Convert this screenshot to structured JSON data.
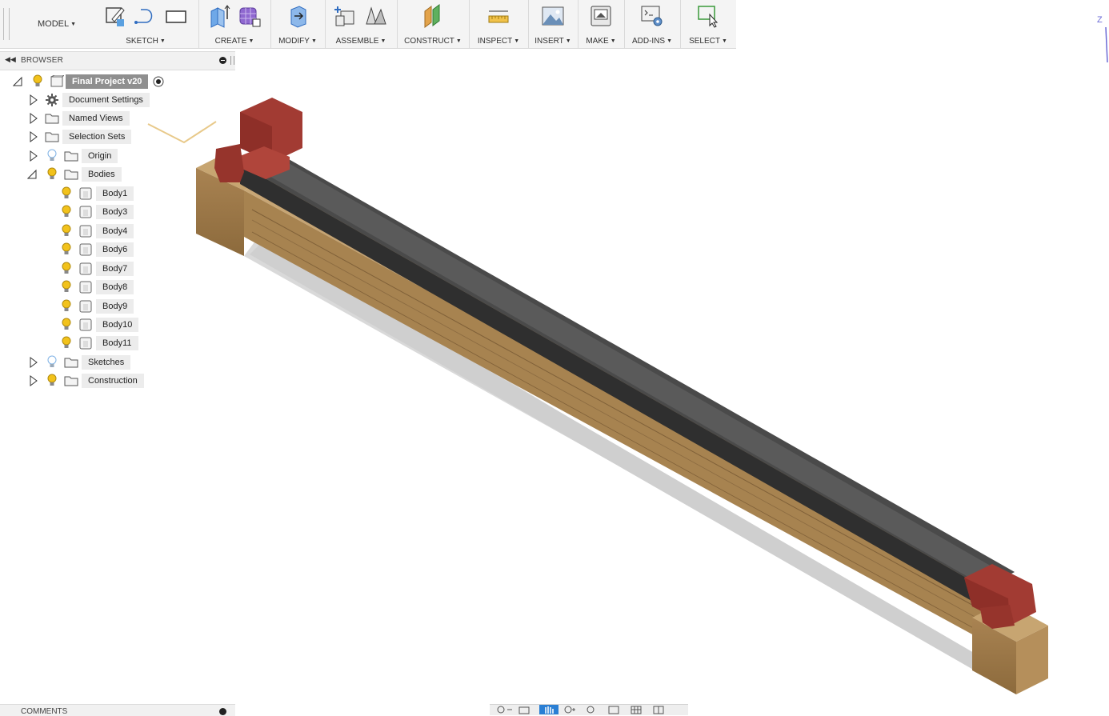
{
  "toolbar": {
    "workspace_label": "MODEL",
    "groups": [
      {
        "label": "SKETCH"
      },
      {
        "label": "CREATE"
      },
      {
        "label": "MODIFY"
      },
      {
        "label": "ASSEMBLE"
      },
      {
        "label": "CONSTRUCT"
      },
      {
        "label": "INSPECT"
      },
      {
        "label": "INSERT"
      },
      {
        "label": "MAKE"
      },
      {
        "label": "ADD-INS"
      },
      {
        "label": "SELECT"
      }
    ]
  },
  "browser": {
    "title": "BROWSER",
    "root": {
      "label": "Final Project v20"
    },
    "items": [
      {
        "label": "Document Settings",
        "icon": "gear-icon"
      },
      {
        "label": "Named Views",
        "icon": "folder-icon"
      },
      {
        "label": "Selection Sets",
        "icon": "folder-icon"
      },
      {
        "label": "Origin",
        "icon": "folder-icon"
      },
      {
        "label": "Bodies",
        "icon": "folder-icon"
      }
    ],
    "bodies": [
      {
        "label": "Body1"
      },
      {
        "label": "Body3"
      },
      {
        "label": "Body4"
      },
      {
        "label": "Body6"
      },
      {
        "label": "Body7"
      },
      {
        "label": "Body8"
      },
      {
        "label": "Body9"
      },
      {
        "label": "Body10"
      },
      {
        "label": "Body11"
      }
    ],
    "after": [
      {
        "label": "Sketches",
        "icon": "folder-icon"
      },
      {
        "label": "Construction",
        "icon": "folder-icon"
      }
    ]
  },
  "comments": {
    "title": "COMMENTS"
  },
  "viewcube": {
    "axis_label": "Z"
  },
  "colors": {
    "wood": "#b08c55",
    "rail": "#3f3f3f",
    "bracket": "#a33a33",
    "bulb": "#f2c21b",
    "bulb_off": "#7fb2e5",
    "nav_active": "#2a7fd4"
  }
}
